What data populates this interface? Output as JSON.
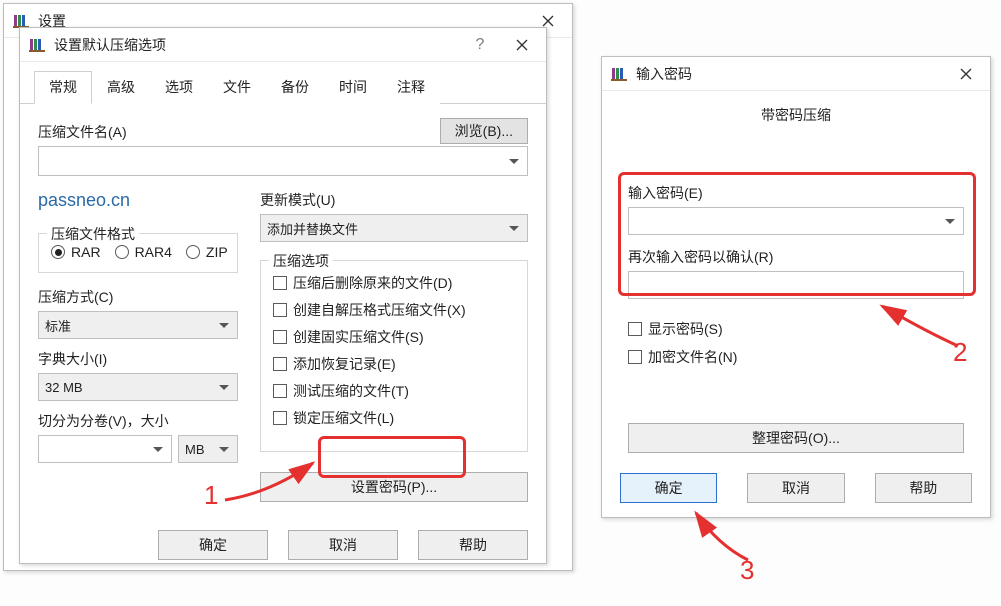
{
  "bg_title": "设置",
  "dialog1": {
    "title": "设置默认压缩选项",
    "tabs": [
      "常规",
      "高级",
      "选项",
      "文件",
      "备份",
      "时间",
      "注释"
    ],
    "archive_name_label": "压缩文件名(A)",
    "browse": "浏览(B)...",
    "archive_name_value": "",
    "watermark": "passneo.cn",
    "update_mode_label": "更新模式(U)",
    "update_mode_value": "添加并替换文件",
    "format_legend": "压缩文件格式",
    "formats": [
      "RAR",
      "RAR4",
      "ZIP"
    ],
    "format_selected": "RAR",
    "method_label": "压缩方式(C)",
    "method_value": "标准",
    "dict_label": "字典大小(I)",
    "dict_value": "32 MB",
    "split_label": "切分为分卷(V)，大小",
    "split_value": "",
    "split_unit": "MB",
    "options_legend": "压缩选项",
    "options": [
      "压缩后删除原来的文件(D)",
      "创建自解压格式压缩文件(X)",
      "创建固实压缩文件(S)",
      "添加恢复记录(E)",
      "测试压缩的文件(T)",
      "锁定压缩文件(L)"
    ],
    "set_password": "设置密码(P)...",
    "ok": "确定",
    "cancel": "取消",
    "help": "帮助"
  },
  "dialog2": {
    "title": "输入密码",
    "heading": "带密码压缩",
    "enter_label": "输入密码(E)",
    "enter_value": "",
    "reenter_label": "再次输入密码以确认(R)",
    "reenter_value": "",
    "show_password": "显示密码(S)",
    "encrypt_names": "加密文件名(N)",
    "organize": "整理密码(O)...",
    "ok": "确定",
    "cancel": "取消",
    "help": "帮助"
  },
  "annotations": {
    "n1": "1",
    "n2": "2",
    "n3": "3"
  }
}
